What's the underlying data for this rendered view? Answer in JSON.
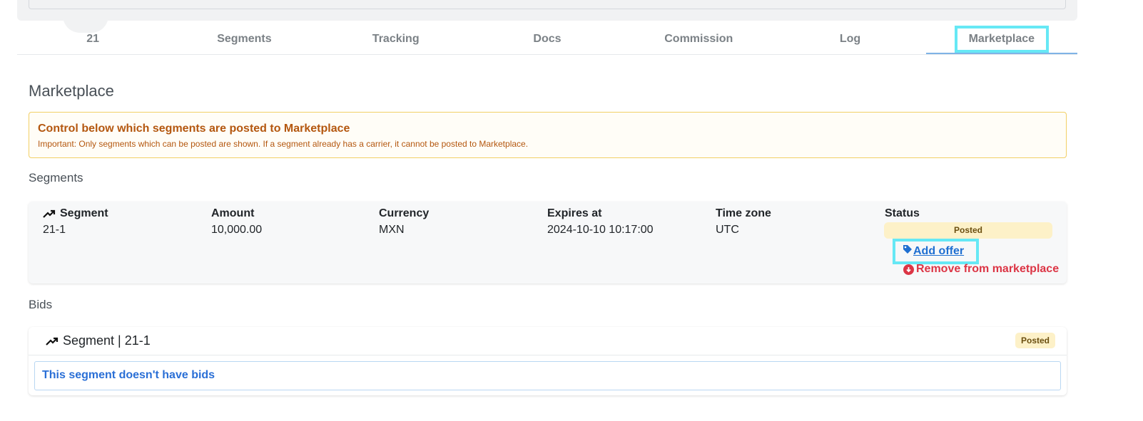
{
  "tabs": [
    {
      "label": "21"
    },
    {
      "label": "Segments"
    },
    {
      "label": "Tracking"
    },
    {
      "label": "Docs"
    },
    {
      "label": "Commission"
    },
    {
      "label": "Log"
    },
    {
      "label": "Marketplace",
      "active": true
    }
  ],
  "page": {
    "title": "Marketplace"
  },
  "alert": {
    "title": "Control below which segments are posted to Marketplace",
    "text": "Important: Only segments which can be posted are shown. If a segment already has a carrier, it cannot be posted to Marketplace."
  },
  "segments_section": {
    "label": "Segments",
    "columns": {
      "segment": "Segment",
      "amount": "Amount",
      "currency": "Currency",
      "expires": "Expires at",
      "timezone": "Time zone",
      "status": "Status"
    },
    "row": {
      "segment": "21-1",
      "amount": "10,000.00",
      "currency": "MXN",
      "expires": "2024-10-10 10:17:00",
      "timezone": "UTC",
      "status": "Posted"
    },
    "actions": {
      "add_offer": "Add offer",
      "remove": "Remove from marketplace"
    }
  },
  "bids_section": {
    "label": "Bids",
    "header": "Segment | 21-1",
    "status": "Posted",
    "empty_message": "This segment doesn't have bids"
  },
  "colors": {
    "accent_highlight": "#66e8f5",
    "link": "#1f6fd1",
    "danger": "#dc3545",
    "warning_text": "#b4570f",
    "badge_bg": "#fdf1c8"
  }
}
